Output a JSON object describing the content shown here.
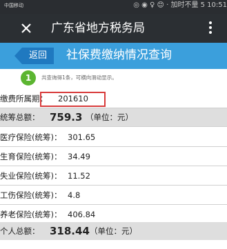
{
  "status_bar": {
    "carrier": "中国移动",
    "right_text": "◎ ◉ ♀ 😊 · 加时不量 5 10:51"
  },
  "app_bar": {
    "title": "广东省地方税务局",
    "close_icon": "close-icon",
    "more_icon": "more-vert-icon"
  },
  "header": {
    "back_label": "返回",
    "page_title": "社保费缴纳情况查询",
    "band_color": "#3b9fdc",
    "back_color": "#1f79c0"
  },
  "info": {
    "step": "1",
    "text": "共查询得1条，可横向滑动显示。",
    "badge_color": "#5cb531"
  },
  "period": {
    "label": "缴费所属期：",
    "value": "201610"
  },
  "pooled_total": {
    "label": "统筹总额：",
    "value": "759.3",
    "unit": "（单位：元）"
  },
  "items": [
    {
      "label": "医疗保险(统筹)：",
      "value": "301.65"
    },
    {
      "label": "生育保险(统筹)：",
      "value": "34.49"
    },
    {
      "label": "失业保险(统筹)：",
      "value": "11.52"
    },
    {
      "label": "工伤保险(统筹)：",
      "value": "4.8"
    },
    {
      "label": "养老保险(统筹)：",
      "value": "406.84"
    }
  ],
  "personal_total": {
    "label": "个人总额：",
    "value": "318.44",
    "unit": "（单位：元）"
  },
  "highlight_color": "#d83a3a"
}
